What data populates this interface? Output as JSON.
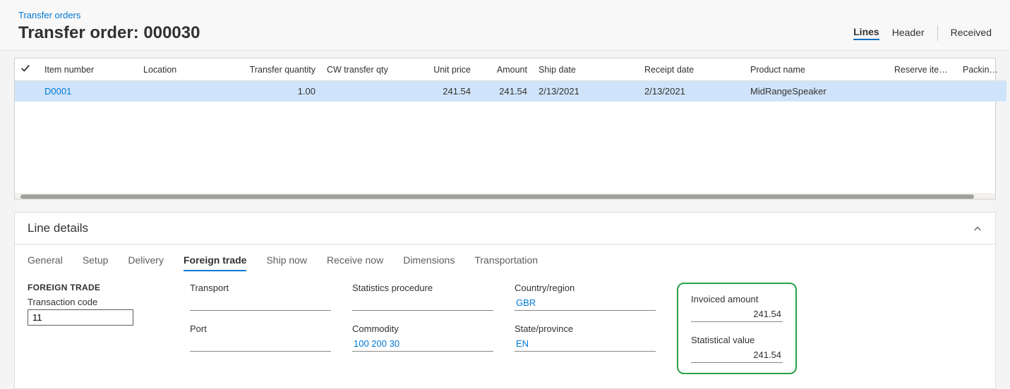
{
  "breadcrumb": "Transfer orders",
  "page_title": "Transfer order: 000030",
  "view_tabs": {
    "lines": "Lines",
    "header": "Header",
    "received": "Received"
  },
  "grid": {
    "columns": {
      "item_number": "Item number",
      "location": "Location",
      "transfer_qty": "Transfer quantity",
      "cw_transfer_qty": "CW transfer qty",
      "unit_price": "Unit price",
      "amount": "Amount",
      "ship_date": "Ship date",
      "receipt_date": "Receipt date",
      "product_name": "Product name",
      "reserve_items": "Reserve items a...",
      "packing_qu": "Packing qu"
    },
    "rows": [
      {
        "item_number": "D0001",
        "location": "",
        "transfer_qty": "1.00",
        "cw_transfer_qty": "",
        "unit_price": "241.54",
        "amount": "241.54",
        "ship_date": "2/13/2021",
        "receipt_date": "2/13/2021",
        "product_name": "MidRangeSpeaker",
        "reserve_items": "",
        "packing_qu": ""
      }
    ]
  },
  "details": {
    "title": "Line details",
    "tabs": {
      "general": "General",
      "setup": "Setup",
      "delivery": "Delivery",
      "foreign_trade": "Foreign trade",
      "ship_now": "Ship now",
      "receive_now": "Receive now",
      "dimensions": "Dimensions",
      "transportation": "Transportation"
    },
    "foreign_trade": {
      "section_title": "FOREIGN TRADE",
      "transaction_code_label": "Transaction code",
      "transaction_code": "11",
      "transport_label": "Transport",
      "transport": "",
      "port_label": "Port",
      "port": "",
      "statistics_procedure_label": "Statistics procedure",
      "statistics_procedure": "",
      "commodity_label": "Commodity",
      "commodity": "100 200 30",
      "country_region_label": "Country/region",
      "country_region": "GBR",
      "state_province_label": "State/province",
      "state_province": "EN",
      "invoiced_amount_label": "Invoiced amount",
      "invoiced_amount": "241.54",
      "statistical_value_label": "Statistical value",
      "statistical_value": "241.54"
    }
  }
}
